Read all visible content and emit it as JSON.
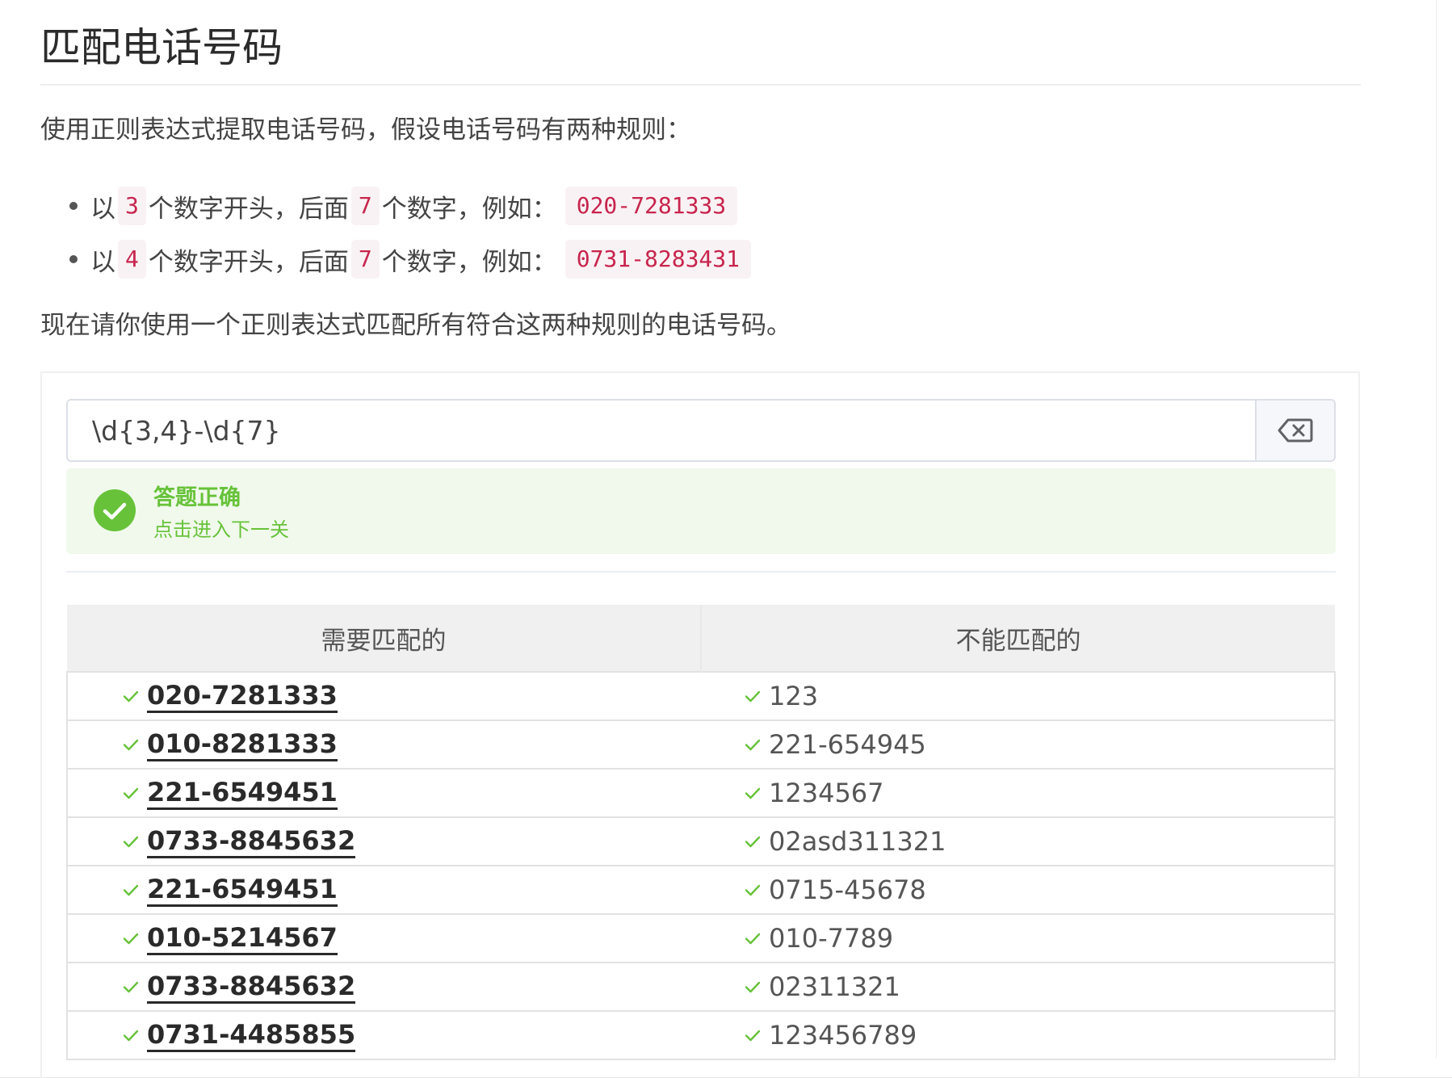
{
  "title": "匹配电话号码",
  "intro": "使用正则表达式提取电话号码，假设电话号码有两种规则：",
  "rules": [
    {
      "prefix": "以",
      "digits": "3",
      "middle": "个数字开头，后面",
      "rest": "7",
      "suffix": "个数字，例如：",
      "example": "020-7281333"
    },
    {
      "prefix": "以",
      "digits": "4",
      "middle": "个数字开头，后面",
      "rest": "7",
      "suffix": "个数字，例如：",
      "example": "0731-8283431"
    }
  ],
  "task": "现在请你使用一个正则表达式匹配所有符合这两种规则的电话号码。",
  "regex": {
    "value": "\\d{3,4}-\\d{7}",
    "clear_icon": "backspace-icon"
  },
  "result": {
    "status": "success",
    "icon": "check-circle-icon",
    "title": "答题正确",
    "action": "点击进入下一关",
    "color": "#67c23a",
    "background": "#f0f9eb"
  },
  "table": {
    "headers": [
      "需要匹配的",
      "不能匹配的"
    ],
    "check_color": "#67c23a",
    "rows": [
      {
        "match": "020-7281333",
        "nomatch": "123"
      },
      {
        "match": "010-8281333",
        "nomatch": "221-654945"
      },
      {
        "match": "221-6549451",
        "nomatch": "1234567"
      },
      {
        "match": "0733-8845632",
        "nomatch": "02asd311321"
      },
      {
        "match": "221-6549451",
        "nomatch": "0715-45678"
      },
      {
        "match": "010-5214567",
        "nomatch": "010-7789"
      },
      {
        "match": "0733-8845632",
        "nomatch": "02311321"
      },
      {
        "match": "0731-4485855",
        "nomatch": "123456789"
      }
    ]
  },
  "accent": {
    "code_text": "#c7254e",
    "code_bg": "#f9f2f4"
  }
}
